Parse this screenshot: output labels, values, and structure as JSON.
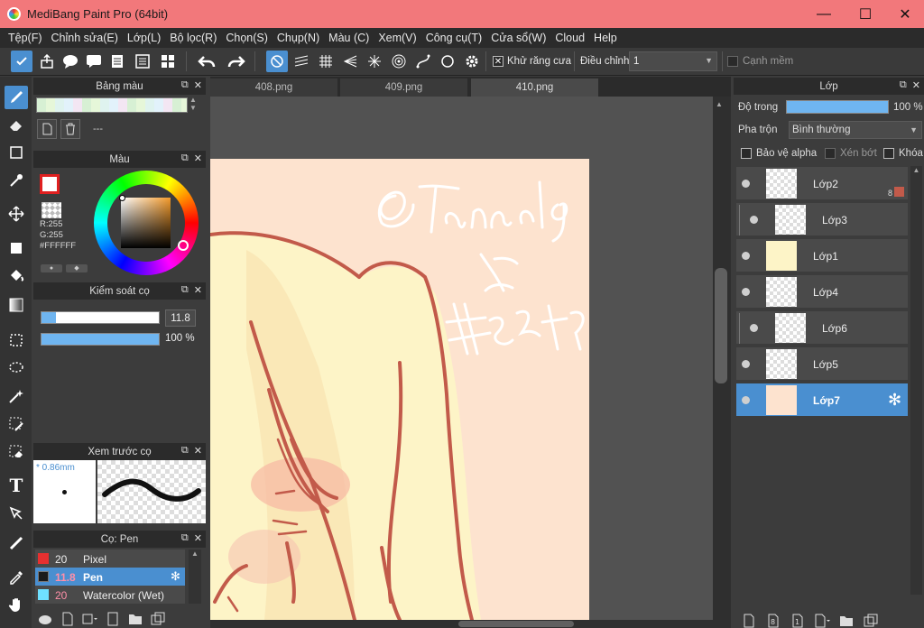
{
  "window": {
    "title": "MediBang Paint Pro (64bit)",
    "minimize": "—",
    "maximize": "☐",
    "close": "✕"
  },
  "menu": [
    "Tệp(F)",
    "Chỉnh sửa(E)",
    "Lớp(L)",
    "Bộ lọc(R)",
    "Chọn(S)",
    "Chụp(N)",
    "Màu (C)",
    "Xem(V)",
    "Công cụ(T)",
    "Cửa sổ(W)",
    "Cloud",
    "Help"
  ],
  "toolbar": {
    "antialias_label": "Khử răng cưa",
    "antialias_checked": "✕",
    "correction_label": "Điều chỉnh",
    "correction_value": "1",
    "smooth_label": "Cạnh mềm"
  },
  "palette_panel": {
    "title": "Bảng màu",
    "value": "---"
  },
  "color_panel": {
    "title": "Màu",
    "r": "R:255",
    "g": "G:255",
    "hex": "#FFFFFF"
  },
  "brush_control": {
    "title": "Kiểm soát cọ",
    "size": "11.8",
    "opacity": "100 %",
    "size_fraction": 0.12,
    "opacity_fraction": 1.0
  },
  "brush_preview": {
    "title": "Xem trước cọ",
    "size": "* 0.86mm"
  },
  "brush_list": {
    "title": "Cọ: Pen",
    "items": [
      {
        "size": "20",
        "name": "Pixel",
        "color": "#e63030",
        "selected": false
      },
      {
        "size": "11.8",
        "name": "Pen",
        "color": "#1b1b1b",
        "selected": true
      },
      {
        "size": "20",
        "name": "Watercolor (Wet)",
        "color": "#6fe0ff",
        "selected": false
      }
    ]
  },
  "doc_tabs": [
    "408.png",
    "409.png",
    "410.png"
  ],
  "layer_panel": {
    "title": "Lớp",
    "opacity_label": "Độ trong",
    "opacity_value": "100 %",
    "opacity_fraction": 1.0,
    "blend_label": "Pha trộn",
    "blend_value": "Bình thường",
    "protect_alpha": "Bảo vệ alpha",
    "clip": "Xén bớt",
    "lock": "Khóa",
    "layers": [
      {
        "name": "Lớp2",
        "badge": "8",
        "selected": false,
        "clipped": false
      },
      {
        "name": "Lớp3",
        "selected": false,
        "clipped": true
      },
      {
        "name": "Lớp1",
        "selected": false,
        "clipped": false
      },
      {
        "name": "Lớp4",
        "selected": false,
        "clipped": false
      },
      {
        "name": "Lớp6",
        "selected": false,
        "clipped": true
      },
      {
        "name": "Lớp5",
        "selected": false,
        "clipped": false
      },
      {
        "name": "Lớp7",
        "selected": true,
        "clipped": false
      }
    ]
  },
  "colors": {
    "accent": "#4a8fd0",
    "titlebar": "#f2787b",
    "canvas": "#fde3cf",
    "line": "#c25a4a"
  }
}
